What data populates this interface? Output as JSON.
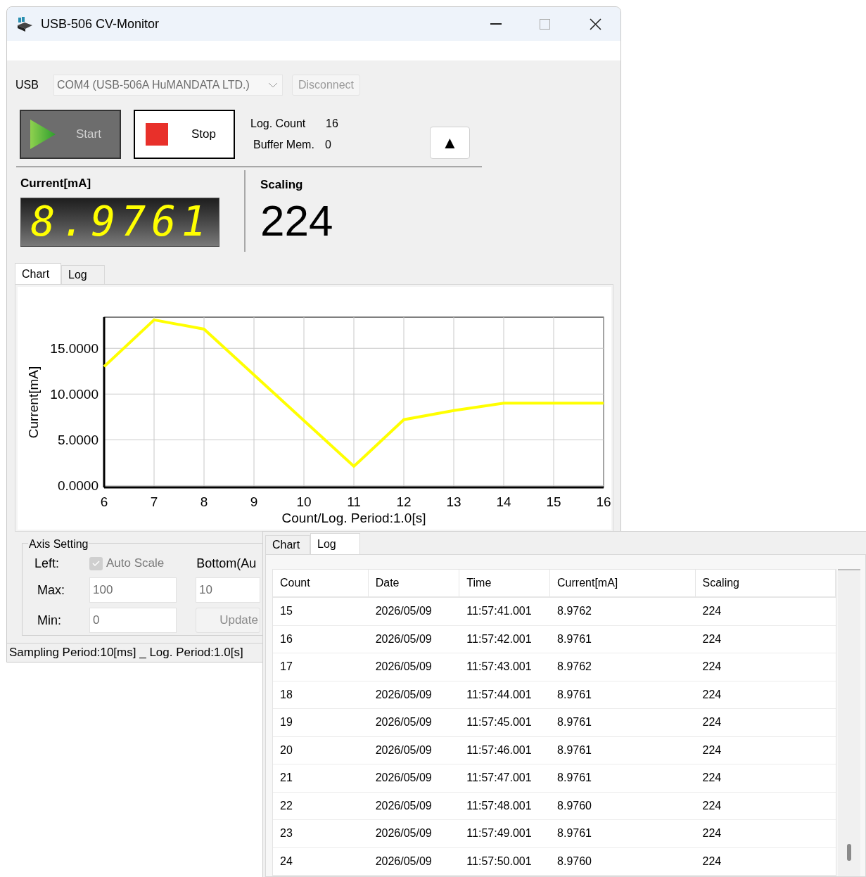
{
  "window": {
    "title": "USB-506 CV-Monitor"
  },
  "connection": {
    "label": "USB",
    "port": "COM4 (USB-506A HuMANDATA LTD.)",
    "disconnect_button": {
      "label": "Disconnect",
      "disabled": true
    }
  },
  "start_button": {
    "label": "Start",
    "disabled": true
  },
  "stop_button": {
    "label": "Stop",
    "disabled": false
  },
  "counters": [
    {
      "label": "Log. Count",
      "value": "16"
    },
    {
      "label": "Buffer Mem.",
      "value": "0"
    }
  ],
  "collapse_button": {
    "label": "▲"
  },
  "current_display": {
    "label": "Current[mA]",
    "value": "8.9761"
  },
  "scaling_display": {
    "label": "Scaling",
    "value": "224"
  },
  "main_tabs": [
    {
      "label": "Chart",
      "selected": true
    },
    {
      "label": "Log",
      "selected": false
    }
  ],
  "chart": {
    "chart_data": {
      "type": "line",
      "xlabel": "Count/Log. Period:1.0[s]",
      "ylabel": "Current[mA]",
      "x": [
        6,
        7,
        8,
        9,
        10,
        11,
        12,
        13,
        14,
        15,
        16
      ],
      "grid": true,
      "series": [
        {
          "color": "#ffff00",
          "values": [
            13.0,
            18.1,
            17.1,
            12.1,
            7.1,
            2.1,
            7.2,
            8.2,
            9.0,
            9.0,
            9.0
          ]
        }
      ],
      "xlim": [
        6,
        16
      ],
      "ylim": [
        -0.2,
        18.4
      ],
      "xticks": [
        6,
        7,
        8,
        9,
        10,
        11,
        12,
        13,
        14,
        15,
        16
      ],
      "yticks": [
        {
          "value": 0,
          "label": "0.0000"
        },
        {
          "value": 5,
          "label": "5.0000"
        },
        {
          "value": 10,
          "label": "10.0000"
        },
        {
          "value": 15,
          "label": "15.0000"
        }
      ]
    }
  },
  "axis_setting": {
    "title": "Axis Setting",
    "left_label": "Left:",
    "auto_scale": {
      "label": "Auto Scale",
      "checked": true,
      "disabled": true
    },
    "max": {
      "label": "Max:",
      "value": "100"
    },
    "min": {
      "label": "Min:",
      "value": "0"
    },
    "bottom_label": "Bottom(Au",
    "bottom_value": "10",
    "update_button": {
      "label": "Update",
      "disabled": true
    }
  },
  "status_bar": "Sampling Period:10[ms] _ Log. Period:1.0[s]",
  "log_panel": {
    "tabs": [
      {
        "label": "Chart",
        "selected": false
      },
      {
        "label": "Log",
        "selected": true
      }
    ],
    "columns": [
      "Count",
      "Date",
      "Time",
      "Current[mA]",
      "Scaling"
    ],
    "rows": [
      [
        "15",
        "2026/05/09",
        "11:57:41.001",
        "8.9762",
        "224"
      ],
      [
        "16",
        "2026/05/09",
        "11:57:42.001",
        "8.9761",
        "224"
      ],
      [
        "17",
        "2026/05/09",
        "11:57:43.001",
        "8.9762",
        "224"
      ],
      [
        "18",
        "2026/05/09",
        "11:57:44.001",
        "8.9761",
        "224"
      ],
      [
        "19",
        "2026/05/09",
        "11:57:45.001",
        "8.9761",
        "224"
      ],
      [
        "20",
        "2026/05/09",
        "11:57:46.001",
        "8.9761",
        "224"
      ],
      [
        "21",
        "2026/05/09",
        "11:57:47.001",
        "8.9761",
        "224"
      ],
      [
        "22",
        "2026/05/09",
        "11:57:48.001",
        "8.9760",
        "224"
      ],
      [
        "23",
        "2026/05/09",
        "11:57:49.001",
        "8.9761",
        "224"
      ],
      [
        "24",
        "2026/05/09",
        "11:57:50.001",
        "8.9760",
        "224"
      ]
    ]
  }
}
